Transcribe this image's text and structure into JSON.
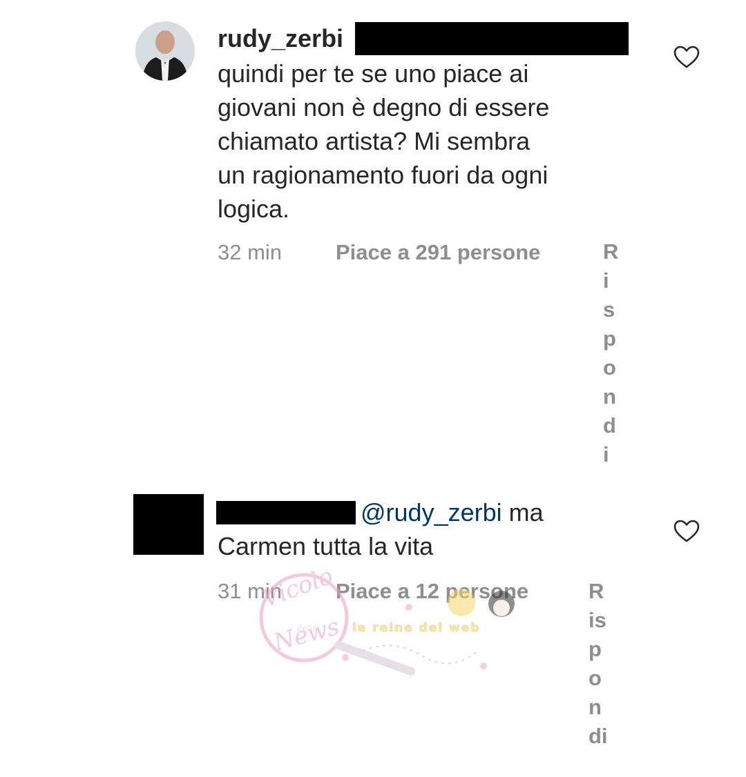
{
  "comments": [
    {
      "username": "rudy_zerbi",
      "text_lines": [
        "quindi per te se uno piace ai",
        "giovani non è degno di essere",
        "chiamato artista? Mi sembra",
        "un ragionamento fuori da ogni",
        "logica."
      ],
      "time": "32 min",
      "likes": "Piace a 291 persone",
      "reply_letters": [
        "R",
        "i",
        "s",
        "p",
        "o",
        "n",
        "d",
        "i"
      ],
      "like_icon": "heart-outline-icon"
    },
    {
      "mention": "@rudy_zerbi",
      "text_first_line_tail": "ma",
      "text_second_line": "Carmen tutta la vita",
      "time": "31 min",
      "likes": "Piace a 12 persone",
      "reply_letters": [
        "R",
        "is",
        "p",
        "o",
        "n",
        "di"
      ],
      "like_icon": "heart-outline-icon"
    }
  ],
  "watermark": {
    "logo_text": [
      "Vicolo",
      "della",
      "News"
    ],
    "tagline": "le reine del web"
  },
  "colors": {
    "text": "#262626",
    "meta": "#8e8e8e",
    "mention": "#00376b",
    "redaction": "#000000",
    "watermark_pink": "#e8a0c0"
  }
}
